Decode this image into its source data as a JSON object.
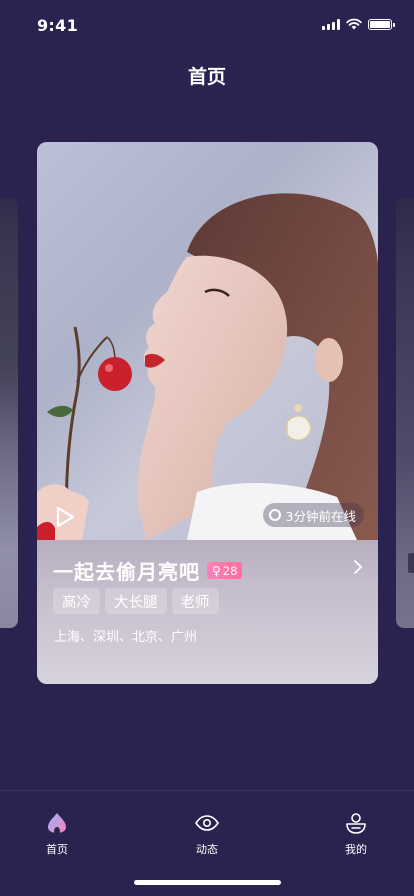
{
  "status": {
    "time": "9:41"
  },
  "header": {
    "title": "首页"
  },
  "card": {
    "name": "一起去偷月亮吧",
    "gender_symbol": "♀",
    "age": "28",
    "online": "3分钟前在线",
    "tags": [
      "高冷",
      "大长腿",
      "老师"
    ],
    "cities": "上海、深圳、北京、广州"
  },
  "tabs": [
    {
      "label": "首页",
      "icon": "home-icon",
      "active": true
    },
    {
      "label": "动态",
      "icon": "eye-icon",
      "active": false
    },
    {
      "label": "我的",
      "icon": "profile-icon",
      "active": false
    }
  ],
  "colors": {
    "background": "#2a2350",
    "badge": "#ff7fb8"
  }
}
